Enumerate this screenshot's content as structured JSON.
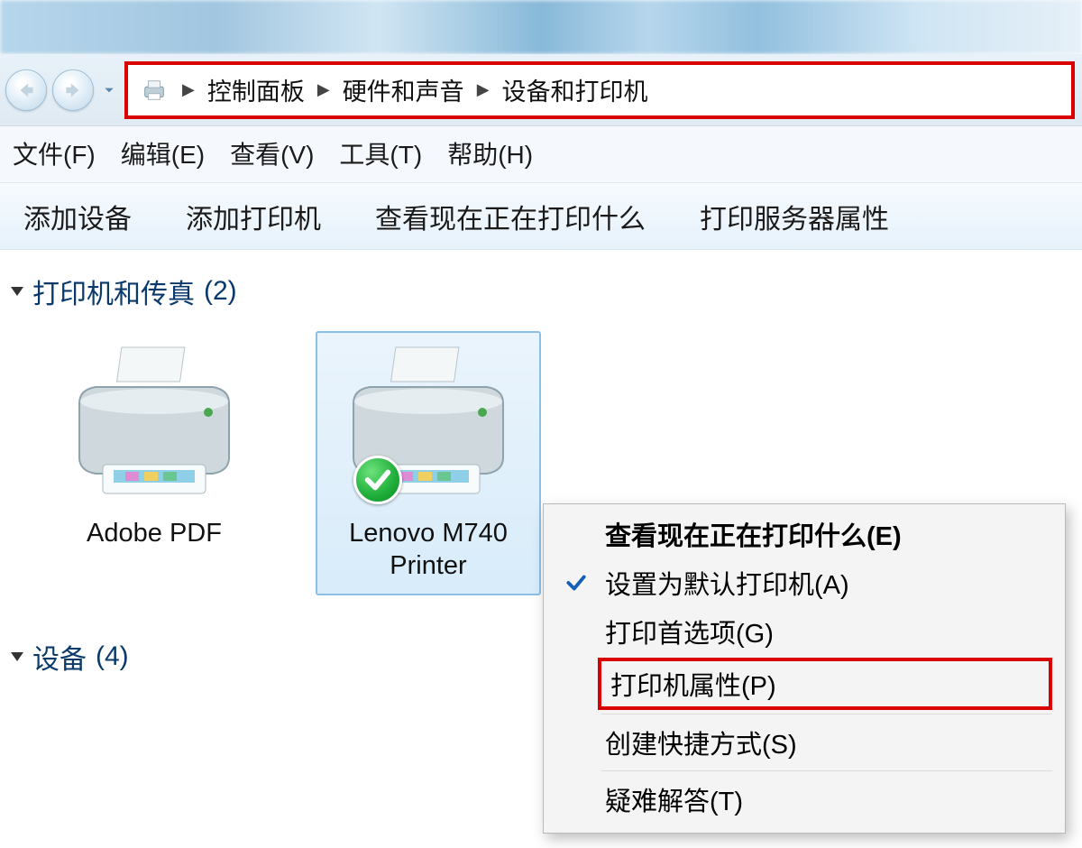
{
  "breadcrumb": {
    "items": [
      "控制面板",
      "硬件和声音",
      "设备和打印机"
    ]
  },
  "menubar": {
    "file": "文件(F)",
    "edit": "编辑(E)",
    "view": "查看(V)",
    "tools": "工具(T)",
    "help": "帮助(H)"
  },
  "cmdbar": {
    "add_device": "添加设备",
    "add_printer": "添加打印机",
    "see_printing": "查看现在正在打印什么",
    "server_props": "打印服务器属性"
  },
  "sections": {
    "printers": {
      "title": "打印机和传真",
      "count_suffix": "(2)"
    },
    "devices": {
      "title": "设备",
      "count_suffix": "(4)"
    }
  },
  "printers": {
    "items": [
      {
        "label": "Adobe PDF"
      },
      {
        "label": "Lenovo M740\nPrinter",
        "default": true
      }
    ]
  },
  "context_menu": {
    "see_printing": "查看现在正在打印什么(E)",
    "set_default": "设置为默认打印机(A)",
    "preferences": "打印首选项(G)",
    "properties": "打印机属性(P)",
    "shortcut": "创建快捷方式(S)",
    "troubleshoot": "疑难解答(T)"
  }
}
